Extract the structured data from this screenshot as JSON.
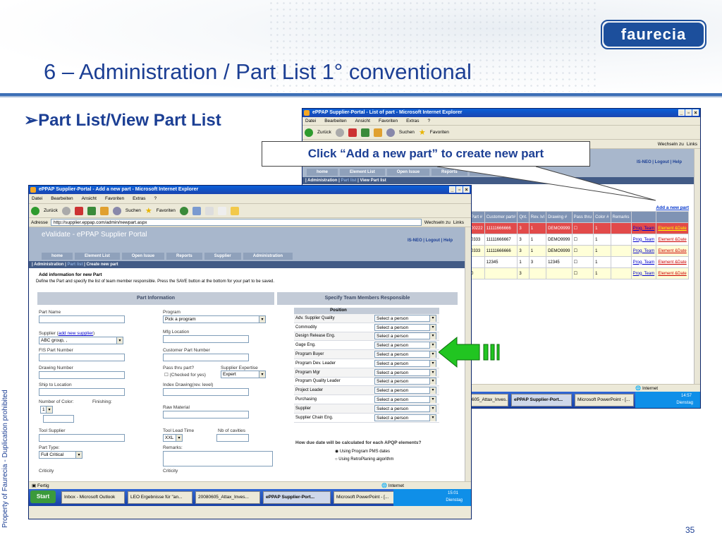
{
  "slide": {
    "brand": "faurecia",
    "title": "6 – Administration / Part List 1°   conventional",
    "bullet": "Part List/View Part List",
    "callout": "Click “Add a new part” to create new part",
    "side_note": "Property of Faurecia - Duplication prohibited",
    "page_number": "35"
  },
  "back_window": {
    "title": "ePPAP Supplier-Portal - List of part - Microsoft Internet Explorer",
    "menu": [
      "Datei",
      "Bearbeiten",
      "Ansicht",
      "Favoriten",
      "Extras",
      "?"
    ],
    "toolbar": {
      "back": "Zurück",
      "search": "Suchen",
      "favorites": "Favoriten"
    },
    "go_label": "Wechseln zu",
    "links_label": "Links",
    "header_links": {
      "user": "IS-NEO",
      "logout": "Logout",
      "help": "Help"
    },
    "nav": [
      "home",
      "Element List",
      "Open Issue",
      "Reports",
      "Supplier"
    ],
    "breadcrumb": {
      "admin": "Administration",
      "part_list": "Part list",
      "view": "View Part list"
    },
    "add_link": "Add a new part",
    "columns": [
      "Part #",
      "Customer part#",
      "Qnt.",
      "Rev. lvl",
      "Drawing #",
      "Pass thru",
      "Color #",
      "Remarks",
      "",
      ""
    ],
    "rows": [
      {
        "part": "00222",
        "cust": "11111666666",
        "qnt": "3",
        "rev": "1",
        "drawing": "DEMO9999",
        "pass": "",
        "color": "1",
        "remarks": "",
        "prog": "Prog. Team",
        "el": "Element &Date",
        "hl": true
      },
      {
        "part": "0333",
        "cust": "11111666667",
        "qnt": "3",
        "rev": "1",
        "drawing": "DEMO9999",
        "pass": "",
        "color": "1",
        "remarks": "",
        "prog": "Prog. Team",
        "el": "Element &Date",
        "hl": false
      },
      {
        "part": "0333",
        "cust": "11111666666",
        "qnt": "3",
        "rev": "1",
        "drawing": "DEMO9999",
        "pass": "",
        "color": "1",
        "remarks": "",
        "prog": "Prog. Team",
        "el": "Element &Date",
        "hl": false
      },
      {
        "part": "",
        "cust": "12345",
        "qnt": "1",
        "rev": "3",
        "drawing": "12345",
        "pass": "",
        "color": "1",
        "remarks": "",
        "prog": "Prog. Team",
        "el": "Element &Date",
        "hl": false
      },
      {
        "part": "0",
        "cust": "",
        "qnt": "3",
        "rev": "",
        "drawing": "",
        "pass": "",
        "color": "1",
        "remarks": "",
        "prog": "Prog. Team",
        "el": "Element &Date",
        "hl": false
      }
    ],
    "status": "Internet",
    "tasks": [
      "605_Attax_Inves...",
      "ePPAP Supplier-Port...",
      "Microsoft PowerPoint - [..."
    ],
    "clock": "14:57",
    "day": "Dienstag"
  },
  "front_window": {
    "title": "ePPAP Supplier-Portal - Add a new part - Microsoft Internet Explorer",
    "menu": [
      "Datei",
      "Bearbeiten",
      "Ansicht",
      "Favoriten",
      "Extras",
      "?"
    ],
    "toolbar": {
      "back": "Zurück",
      "search": "Suchen",
      "favorites": "Favoriten"
    },
    "address_label": "Adresse",
    "url": "http://supplier.eppap.com/admin/newpart.aspx",
    "go_label": "Wechseln zu",
    "links_label": "Links",
    "portal_title": "eValidate - ePPAP Supplier Portal",
    "header_links": {
      "user": "IS-NEO",
      "logout": "Logout",
      "help": "Help"
    },
    "nav": [
      "home",
      "Element List",
      "Open Issue",
      "Reports",
      "Supplier",
      "Administration"
    ],
    "breadcrumb": {
      "admin": "Administration",
      "part_list": "Part list",
      "create": "Create new part"
    },
    "form_heading": "Add information for new Part",
    "form_desc": "Define the Part and specify the list of team member responsible. Press the SAVE button at the bottom for your part to be saved.",
    "part_info_title": "Part Information",
    "team_title": "Specify Team Members Responsible",
    "fields": {
      "part_name": "Part Name",
      "program": "Program",
      "program_value": "Pick a program",
      "supplier": "Supplier (",
      "add_supplier": "add new supplier",
      ")": ")",
      "supplier_value": "ABC group, ,",
      "mfg_location": "Mfg Location",
      "fis_part": "FIS Part Number",
      "customer_part": "Customer Part Number",
      "drawing_number": "Drawing Number",
      "pass_thru": "Pass thru part?",
      "checked_yes": "(Checked for yes)",
      "supplier_expertise": "Supplier Expertise",
      "expertise_value": "Expert",
      "ship_to": "Ship to Location",
      "index_drawing": "Index Drawing(rev. level)",
      "num_color": "Number of Color:",
      "num_color_value": "1",
      "finishing": "Finishing:",
      "raw_material": "Raw Material",
      "tool_supplier": "Tool Supplier",
      "tool_lead": "Tool Lead Time",
      "tool_lead_value": "XXL",
      "nb_cavities": "Nb of cavities",
      "part_type": "Part Type:",
      "part_type_value": "Full Critical",
      "remarks": "Remarks:",
      "criticity": "Criticity",
      "criticity2": "Criticity"
    },
    "position_header": "Position",
    "positions": [
      "Adv. Supplier Quality",
      "Commodity",
      "Design Release Eng.",
      "Gage Eng.",
      "Program Buyer",
      "Program Dev. Leader",
      "Program Mgr",
      "Program Quality Leader",
      "Project Leader",
      "Purchasing",
      "Supplier",
      "Supplier Chain Eng."
    ],
    "select_placeholder": "Select a person",
    "due_question": "How due date will be calculated for  each APQP elements?",
    "radio1": "Using Program PMS dates",
    "radio2": "Using RetroPlaning algorithm",
    "status_left": "Fertig",
    "status_right": "Internet",
    "start_label": "Start",
    "tasks": [
      "Inbox - Microsoft Outlook",
      "LEO Ergebnisse für \"an...",
      "20080605_Attax_Inves...",
      "ePPAP Supplier-Port...",
      "Microsoft PowerPoint - [..."
    ],
    "clock": "15:01",
    "day": "Dienstag"
  }
}
